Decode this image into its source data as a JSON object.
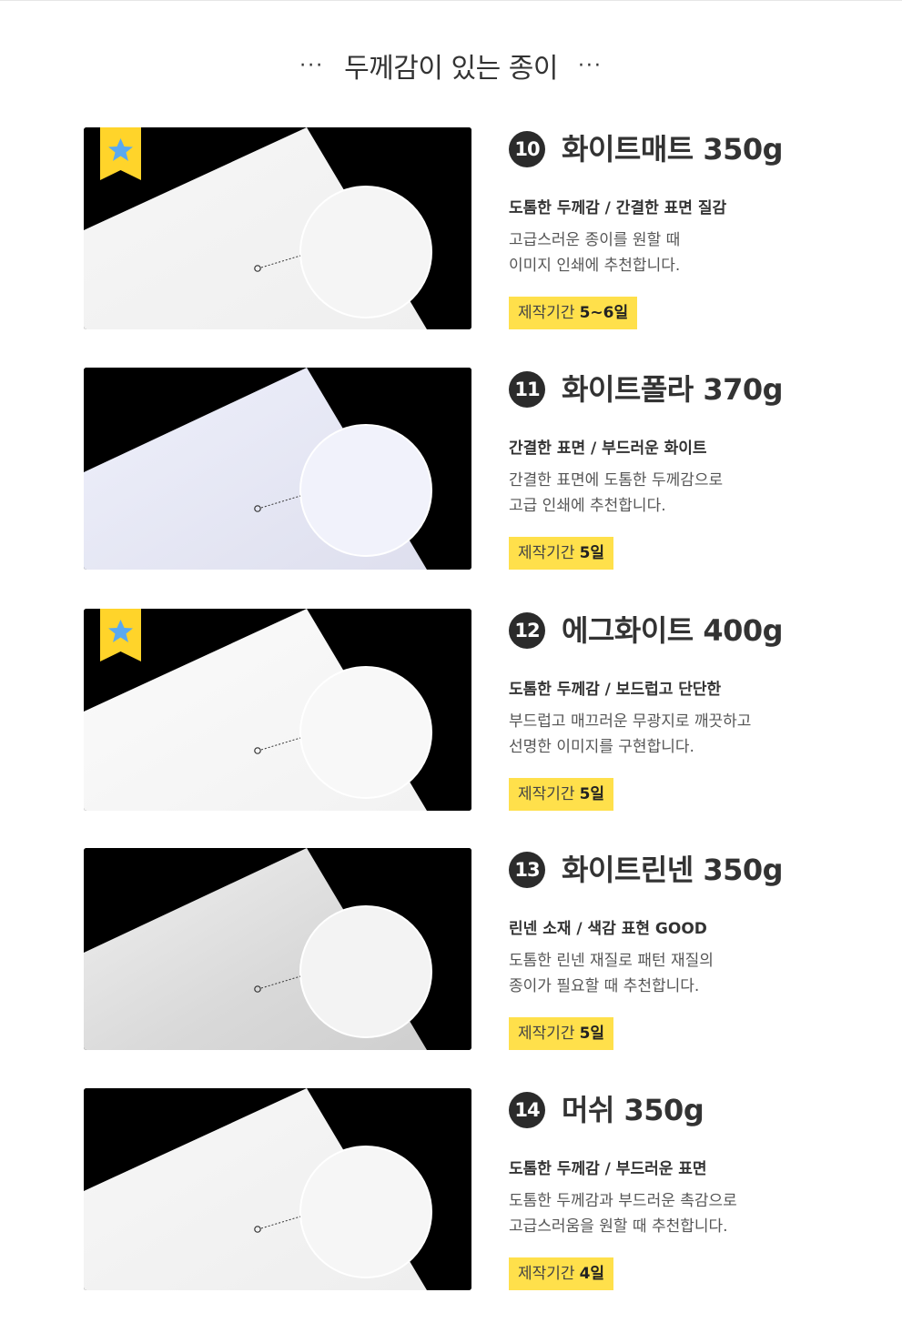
{
  "section": {
    "title": "두께감이 있는 종이",
    "left_dots": "···",
    "right_dots": "···"
  },
  "products": [
    {
      "number": "10",
      "name": "화이트매트 350g",
      "subtitle": "도톰한 두께감 / 간결한 표면 질감",
      "desc_line1": "고급스러운 종이를 원할 때",
      "desc_line2": "이미지 인쇄에 추천합니다.",
      "period_label": "제작기간",
      "period_value": "5~6일",
      "featured": true
    },
    {
      "number": "11",
      "name": "화이트폴라 370g",
      "subtitle": "간결한 표면 / 부드러운 화이트",
      "desc_line1": "간결한 표면에 도톰한 두께감으로",
      "desc_line2": "고급 인쇄에 추천합니다.",
      "period_label": "제작기간",
      "period_value": "5일",
      "featured": false
    },
    {
      "number": "12",
      "name": "에그화이트 400g",
      "subtitle": "도톰한 두께감 / 보드럽고 단단한",
      "desc_line1": "부드럽고 매끄러운 무광지로 깨끗하고",
      "desc_line2": "선명한 이미지를 구현합니다.",
      "period_label": "제작기간",
      "period_value": "5일",
      "featured": true
    },
    {
      "number": "13",
      "name": "화이트린넨 350g",
      "subtitle": "린넨 소재 / 색감 표현 GOOD",
      "desc_line1": "도톰한 린넨 재질로 패턴 재질의",
      "desc_line2": "종이가 필요할 때 추천합니다.",
      "period_label": "제작기간",
      "period_value": "5일",
      "featured": false
    },
    {
      "number": "14",
      "name": "머쉬 350g",
      "subtitle": "도톰한 두께감 / 부드러운 표면",
      "desc_line1": "도톰한 두께감과 부드러운 촉감으로",
      "desc_line2": "고급스러움을 원할 때 추천합니다.",
      "period_label": "제작기간",
      "period_value": "4일",
      "featured": false
    }
  ],
  "colors": {
    "highlight": "#ffe04b",
    "badge_bg": "#ffd42a",
    "star": "#5aa9f0",
    "number_circle": "#2b2b2b"
  },
  "icons": {
    "featured": "star-bookmark-icon",
    "zoom_pointer": "zoom-pointer-icon"
  }
}
